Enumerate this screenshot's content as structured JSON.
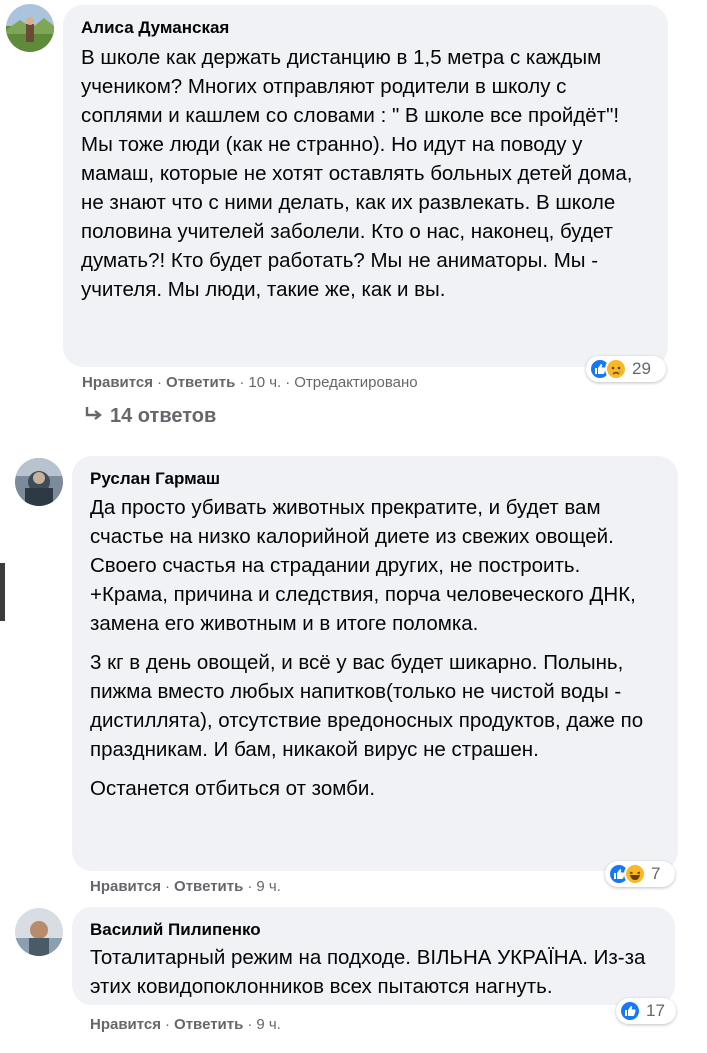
{
  "colors": {
    "bubble": "#f0f2f5",
    "meta": "#65676b",
    "like": "#1877f2",
    "emoji": "#f7b928"
  },
  "comments": [
    {
      "author": "Алиса Думанская",
      "paragraphs": [
        "В школе как держать дистанцию в 1,5 метра с каждым учеником? Многих отправляют родители в школу с соплями и кашлем со словами : \" В школе все пройдёт\"! Мы тоже люди (как не странно). Но идут на поводу у мамаш, которые не хотят оставлять больных детей дома, не знают что с ними делать, как их развлекать. В школе половина учителей заболели. Кто о нас, наконец, будет думать?! Кто будет работать? Мы не аниматоры. Мы - учителя. Мы люди, такие же, как и вы."
      ],
      "like_label": "Нравится",
      "reply_label": "Ответить",
      "time": "10 ч.",
      "edited": "Отредактировано",
      "reaction_icons": [
        "like-icon",
        "sad-icon"
      ],
      "reaction_count": "29",
      "replies_label": "14 ответов"
    },
    {
      "author": "Руслан Гармаш",
      "paragraphs": [
        "Да просто убивать животных прекратите, и будет вам счастье на низко калорийной диете из свежих овощей. Своего счастья на страдании других, не построить. +Крама, причина и следствия, порча человеческого ДНК, замена его животным и в итоге поломка.",
        "3 кг в день овощей, и всё у вас будет шикарно. Полынь, пижма вместо любых напитков(только не чистой воды - дистиллята), отсутствие вредоносных продуктов, даже по праздникам. И бам, никакой вирус не страшен.",
        "Останется отбиться от зомби."
      ],
      "like_label": "Нравится",
      "reply_label": "Ответить",
      "time": "9 ч.",
      "reaction_icons": [
        "like-icon",
        "haha-icon"
      ],
      "reaction_count": "7"
    },
    {
      "author": "Василий Пилипенко",
      "paragraphs": [
        "Тоталитарный режим на подходе. ВІЛЬНА УКРАЇНА. Из-за этих ковидопоклонников всех пытаются нагнуть."
      ],
      "like_label": "Нравится",
      "reply_label": "Ответить",
      "time": "9 ч.",
      "reaction_icons": [
        "like-icon"
      ],
      "reaction_count": "17"
    }
  ]
}
